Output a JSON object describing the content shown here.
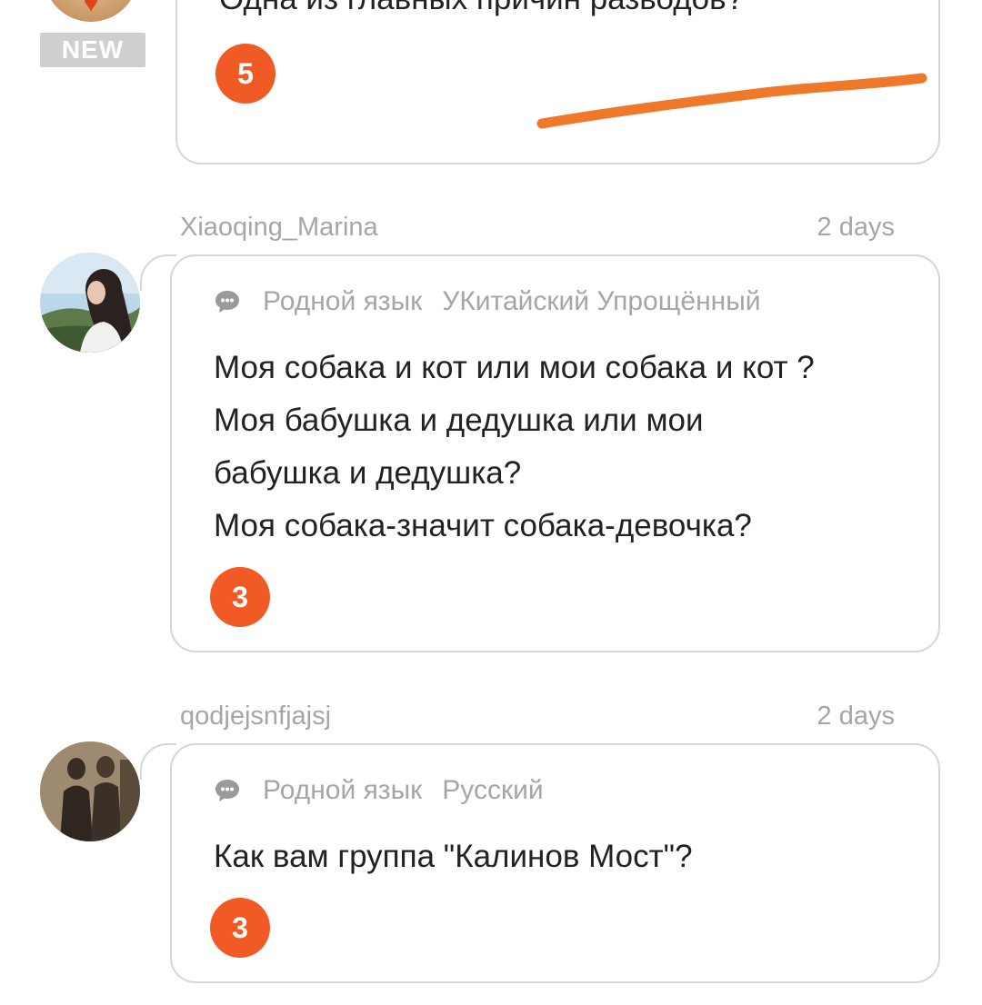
{
  "posts": [
    {
      "badge": "NEW",
      "question": "Одна из главных причин разводов?",
      "count": "5"
    },
    {
      "username": "Xiaoqing_Marina",
      "time": "2 days",
      "tag_label": "Родной язык",
      "tag_value": "УКитайский Упрощённый",
      "question": "Моя собака и кот или мои собака и кот ?\nМоя бабушка и дедушка или мои\nбабушка и дедушка?\nМоя собака-значит собака-девочка?",
      "count": "3"
    },
    {
      "username": "qodjejsnfjajsj",
      "time": "2 days",
      "tag_label": "Родной язык",
      "tag_value": "Русский",
      "question": "Как вам группа \"Калинов Мост\"?",
      "count": "3"
    }
  ],
  "icons": {
    "chat": "chat-bubble-icon",
    "heart": "heart-icon"
  },
  "colors": {
    "accent": "#f15a24",
    "annotation_stroke": "#f0782a",
    "muted_text": "#a6a6a6",
    "border": "#d6d6d6",
    "new_badge_bg": "#cfcfcf"
  }
}
